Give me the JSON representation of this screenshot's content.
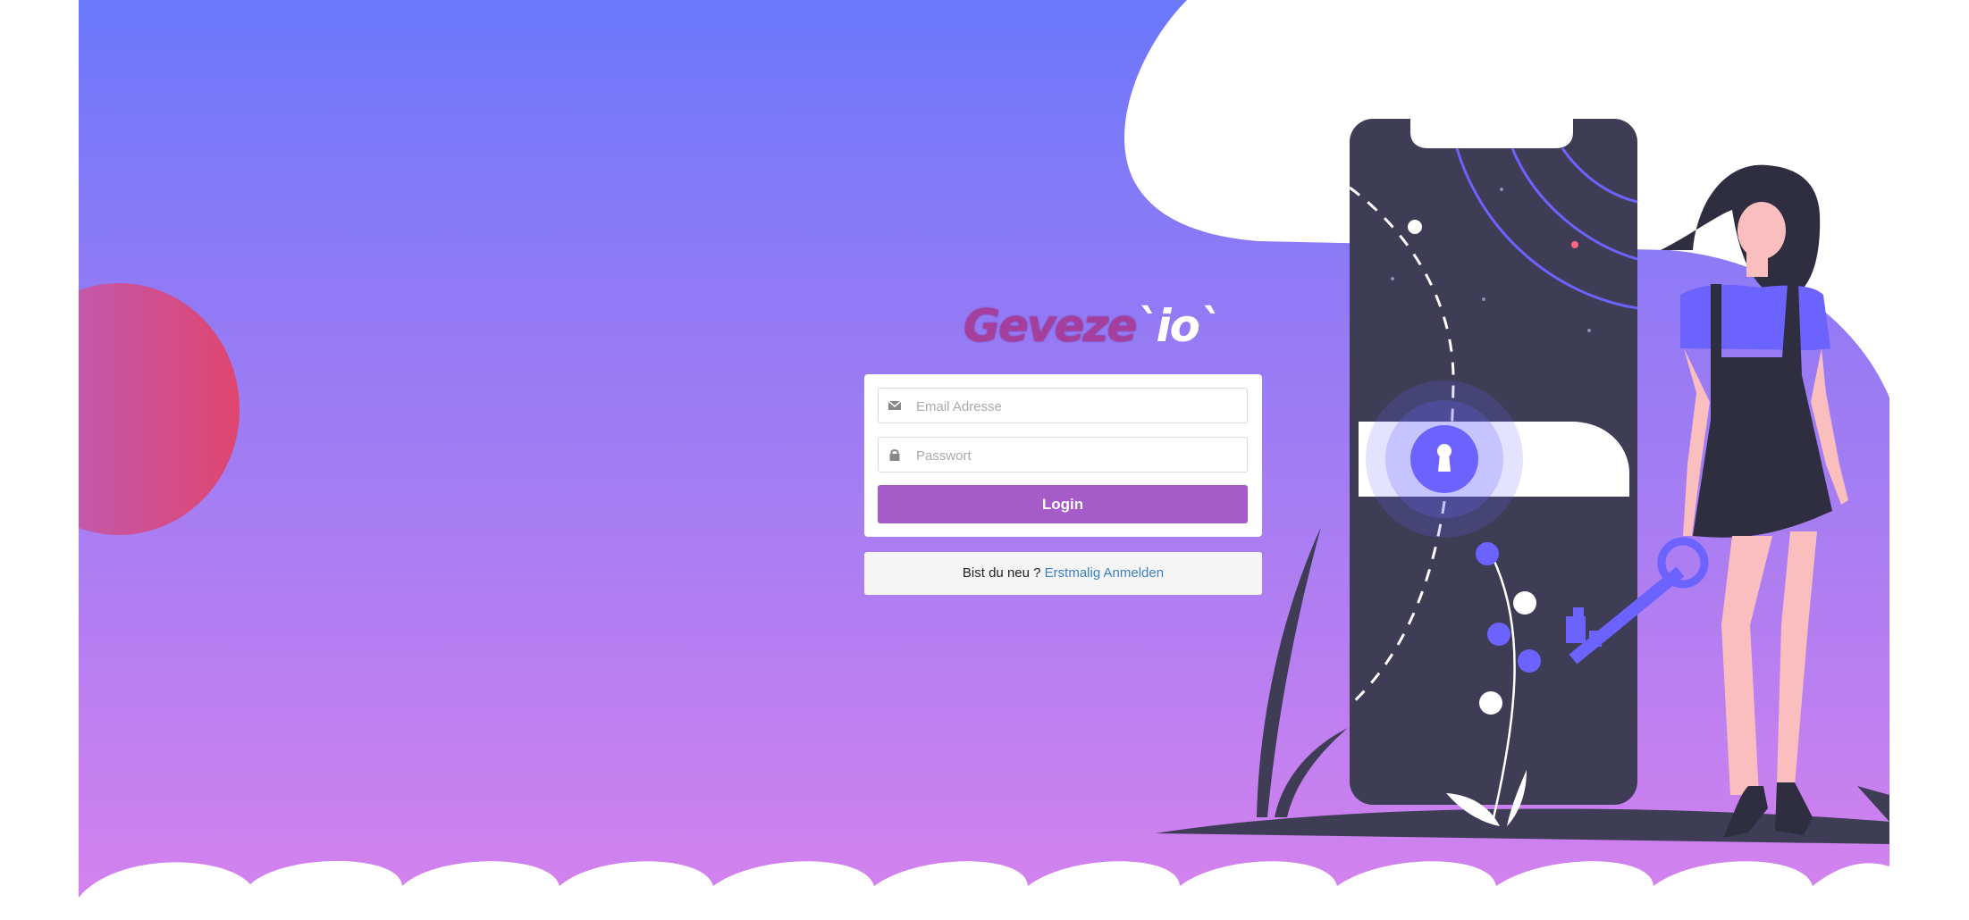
{
  "logo": {
    "part1": "Geveze",
    "part2": "`io`"
  },
  "form": {
    "email_placeholder": "Email Adresse",
    "password_placeholder": "Passwort",
    "login_label": "Login"
  },
  "signup": {
    "prompt": "Bist du neu ?",
    "link": "Erstmalig Anmelden"
  },
  "icons": {
    "email": "envelope-icon",
    "password": "lock-icon"
  },
  "colors": {
    "bg_top": "#6a78fb",
    "bg_bottom": "#d682ee",
    "button": "#a55bc8",
    "link": "#3b7fc4"
  }
}
